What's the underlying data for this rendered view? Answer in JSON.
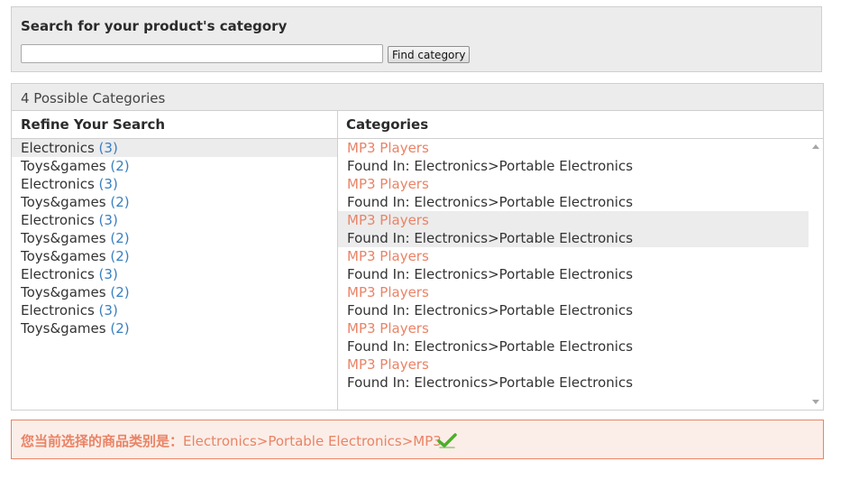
{
  "search": {
    "title": "Search for your product's category",
    "input_value": "",
    "input_placeholder": "",
    "button_label": "Find category"
  },
  "results": {
    "count_text": "4 Possible Categories",
    "refine_header": "Refine Your Search",
    "categories_header": "Categories",
    "refine_items": [
      {
        "label": "Electronics",
        "count": "(3)",
        "selected": true
      },
      {
        "label": "Toys&games",
        "count": "(2)",
        "selected": false
      },
      {
        "label": "Electronics",
        "count": "(3)",
        "selected": false
      },
      {
        "label": "Toys&games",
        "count": "(2)",
        "selected": false
      },
      {
        "label": "Electronics",
        "count": "(3)",
        "selected": false
      },
      {
        "label": "Toys&games",
        "count": "(2)",
        "selected": false
      },
      {
        "label": "Toys&games",
        "count": "(2)",
        "selected": false
      },
      {
        "label": "Electronics",
        "count": "(3)",
        "selected": false
      },
      {
        "label": "Toys&games",
        "count": "(2)",
        "selected": false
      },
      {
        "label": "Electronics",
        "count": "(3)",
        "selected": false
      },
      {
        "label": "Toys&games",
        "count": "(2)",
        "selected": false
      }
    ],
    "category_items": [
      {
        "name": "MP3 Players",
        "path": "Found In: Electronics>Portable Electronics",
        "selected": false
      },
      {
        "name": "MP3 Players",
        "path": "Found In: Electronics>Portable Electronics",
        "selected": false
      },
      {
        "name": "MP3 Players",
        "path": "Found In: Electronics>Portable Electronics",
        "selected": true
      },
      {
        "name": "MP3 Players",
        "path": "Found In: Electronics>Portable Electronics",
        "selected": false
      },
      {
        "name": "MP3 Players",
        "path": "Found In: Electronics>Portable Electronics",
        "selected": false
      },
      {
        "name": "MP3 Players",
        "path": "Found In: Electronics>Portable Electronics",
        "selected": false
      },
      {
        "name": "MP3 Players",
        "path": "Found In: Electronics>Portable Electronics",
        "selected": false
      }
    ]
  },
  "selection": {
    "label": "您当前选择的商品类别是：",
    "value": "Electronics>Portable Electronics>MP3",
    "icon": "checkmark-icon"
  },
  "colors": {
    "accent": "#ea8366",
    "count_link": "#3a7fbf",
    "panel_bg": "#ececec",
    "check_green": "#4caf2a"
  }
}
